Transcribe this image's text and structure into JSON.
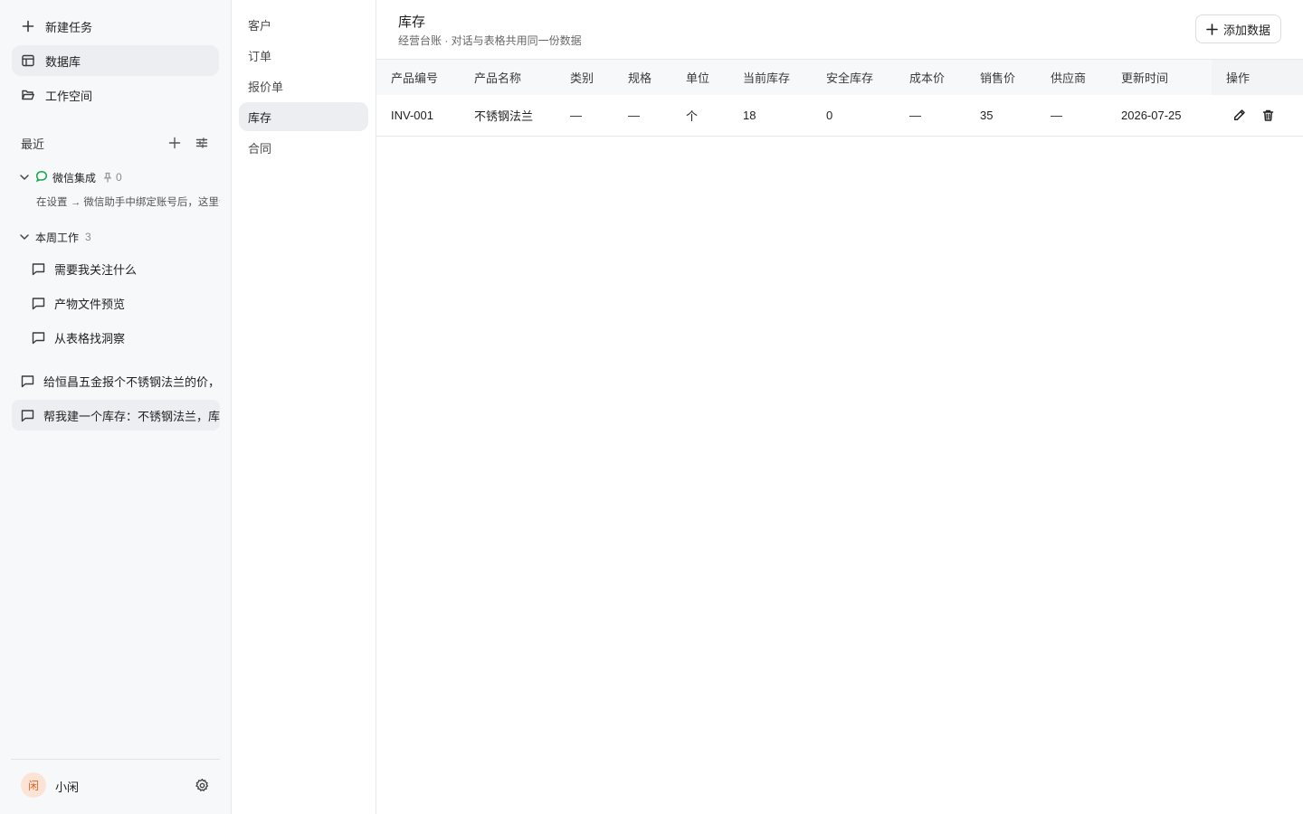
{
  "sidebar": {
    "new_task": "新建任务",
    "database": "数据库",
    "workspace": "工作空间",
    "recent_title": "最近",
    "groups": [
      {
        "label": "微信集成",
        "count": "0",
        "hint": "在设置 → 微信助手中绑定账号后，这里会"
      },
      {
        "label": "本周工作",
        "count": "3",
        "items": [
          "需要我关注什么",
          "产物文件预览",
          "从表格找洞察"
        ]
      }
    ],
    "chats": [
      "给恒昌五金报个不锈钢法兰的价，",
      "帮我建一个库存：不锈钢法兰，库"
    ],
    "user": {
      "avatar_char": "闲",
      "name": "小闲"
    }
  },
  "tables": [
    "客户",
    "订单",
    "报价单",
    "库存",
    "合同"
  ],
  "active_table": "库存",
  "main": {
    "title": "库存",
    "subtitle": "经营台账 · 对话与表格共用同一份数据",
    "add_button": "添加数据",
    "columns": [
      "产品编号",
      "产品名称",
      "类别",
      "规格",
      "单位",
      "当前库存",
      "安全库存",
      "成本价",
      "销售价",
      "供应商",
      "更新时间",
      "操作"
    ],
    "rows": [
      [
        "INV-001",
        "不锈钢法兰",
        "—",
        "—",
        "个",
        "18",
        "0",
        "—",
        "35",
        "—",
        "2026-07-25"
      ]
    ]
  },
  "colors": {
    "wechat_green": "#16a34a",
    "avatar_bg": "#fbe4d6",
    "avatar_fg": "#d9652b"
  }
}
